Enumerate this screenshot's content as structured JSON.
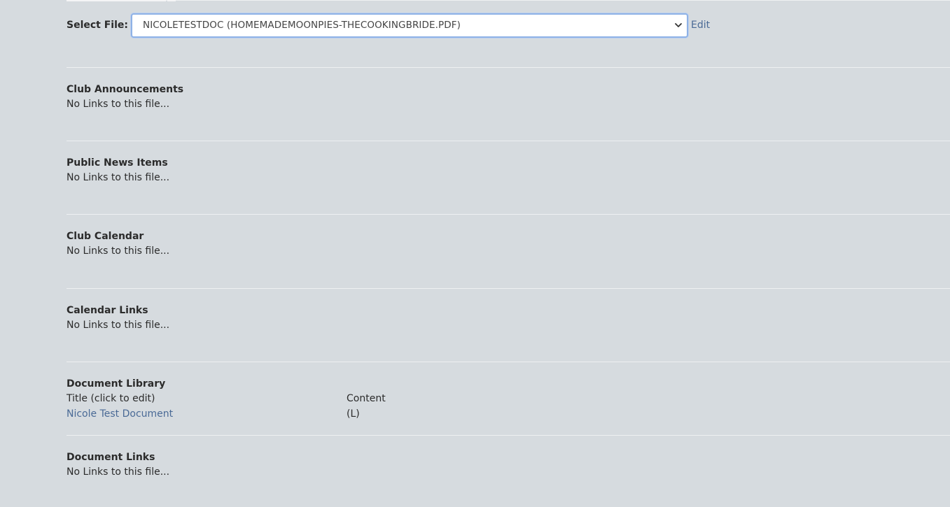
{
  "file_selector": {
    "label": "Select File:",
    "selected": "NICOLETESTDOC (HOMEMADEMOONPIES-THECOOKINGBRIDE.PDF)",
    "edit_label": "Edit"
  },
  "sections": {
    "club_announcements": {
      "title": "Club Announcements",
      "text": "No Links to this file..."
    },
    "public_news": {
      "title": "Public News Items",
      "text": "No Links to this file..."
    },
    "club_calendar": {
      "title": "Club Calendar",
      "text": "No Links to this file..."
    },
    "calendar_links": {
      "title": "Calendar Links",
      "text": "No Links to this file..."
    },
    "document_library": {
      "title": "Document Library",
      "columns": [
        "Title (click to edit)",
        "Content"
      ],
      "rows": [
        {
          "title": "Nicole Test Document",
          "content": "(L)"
        }
      ]
    },
    "document_links": {
      "title": "Document Links",
      "text": "No Links to this file..."
    }
  },
  "colors": {
    "background": "#d6dbdf",
    "link": "#4a6a96",
    "select_focus_border": "#8fb2e6"
  }
}
